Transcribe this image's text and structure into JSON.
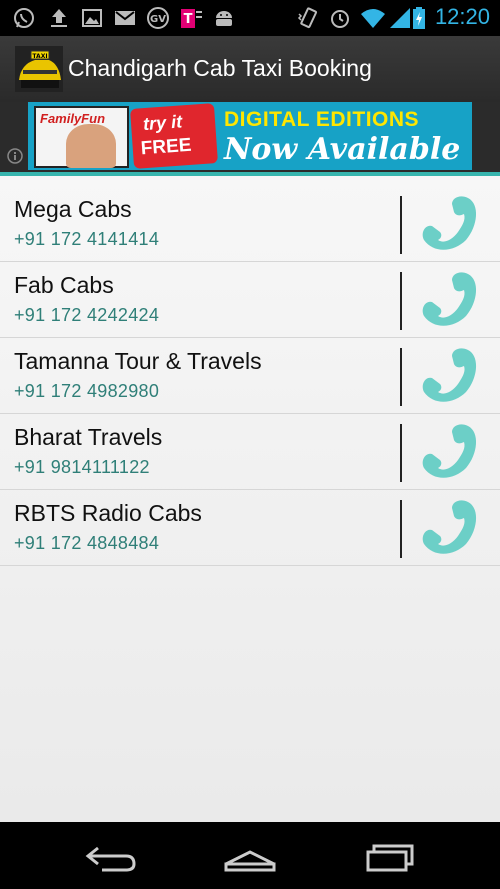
{
  "status_bar": {
    "time": "12:20",
    "left_icons": [
      "whatsapp-icon",
      "upload-icon",
      "image-icon",
      "gmail-icon",
      "google-voice-icon",
      "tmobile-icon",
      "android-icon"
    ],
    "right_icons": [
      "vibrate-icon",
      "alarm-icon",
      "wifi-icon",
      "signal-icon",
      "battery-charging-icon"
    ]
  },
  "action_bar": {
    "title": "Chandigarh Cab Taxi Booking",
    "icon": "taxi-app-icon"
  },
  "ad": {
    "magazine": "FamilyFun",
    "try_line": "try it",
    "free_line": "FREE",
    "line1": "DIGITAL EDITIONS",
    "line2": "Now Available",
    "colors": {
      "background": "#17a2c6",
      "headline": "#ffe600",
      "badge": "#e0262d"
    }
  },
  "cabs": [
    {
      "name": "Mega Cabs",
      "phone": "+91 172 4141414"
    },
    {
      "name": "Fab Cabs",
      "phone": "+91 172 4242424"
    },
    {
      "name": "Tamanna Tour & Travels",
      "phone": "+91 172 4982980"
    },
    {
      "name": "Bharat Travels",
      "phone": "+91 9814111122"
    },
    {
      "name": "RBTS Radio Cabs",
      "phone": "+91 172 4848484"
    }
  ],
  "colors": {
    "accent": "#37b5ae",
    "phone_text": "#2f7f78",
    "call_icon": "#6ccfc7",
    "clock": "#33b5e5"
  },
  "nav_bar": {
    "buttons": [
      "back-icon",
      "home-icon",
      "recent-apps-icon"
    ]
  }
}
